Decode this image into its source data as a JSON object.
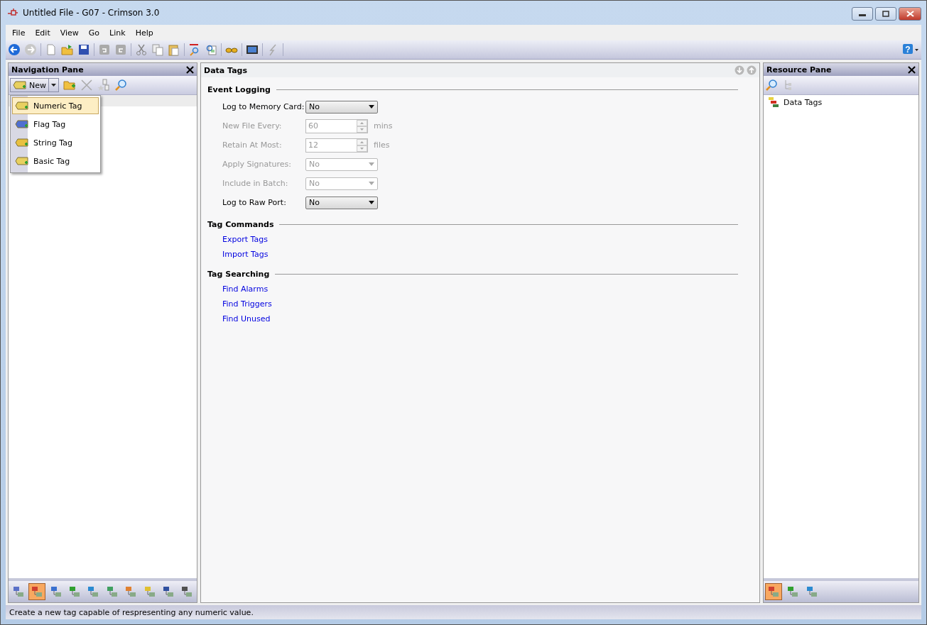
{
  "window": {
    "title": "Untitled File - G07 - Crimson 3.0"
  },
  "menu": [
    "File",
    "Edit",
    "View",
    "Go",
    "Link",
    "Help"
  ],
  "toolbar": {
    "help_glyph": "?"
  },
  "navigation_pane": {
    "title": "Navigation Pane",
    "new_button": "New",
    "new_menu": [
      {
        "label": "Numeric Tag",
        "kind": "numeric",
        "selected": true
      },
      {
        "label": "Flag Tag",
        "kind": "flag",
        "selected": false
      },
      {
        "label": "String Tag",
        "kind": "string",
        "selected": false
      },
      {
        "label": "Basic Tag",
        "kind": "basic",
        "selected": false
      }
    ],
    "bottom_tabs": [
      {
        "kind": "comms",
        "selected": false
      },
      {
        "kind": "tags",
        "selected": true
      },
      {
        "kind": "users",
        "selected": false
      },
      {
        "kind": "tree",
        "selected": false
      },
      {
        "kind": "web",
        "selected": false
      },
      {
        "kind": "chart",
        "selected": false
      },
      {
        "kind": "security",
        "selected": false
      },
      {
        "kind": "database",
        "selected": false
      },
      {
        "kind": "network",
        "selected": false
      },
      {
        "kind": "module",
        "selected": false
      }
    ]
  },
  "editor": {
    "title": "Data Tags",
    "sections": [
      {
        "title": "Event Logging",
        "rows": [
          {
            "label": "Log to Memory Card:",
            "kind": "dropdown",
            "value": "No",
            "disabled": false
          },
          {
            "label": "New File Every:",
            "kind": "spinner",
            "value": "60",
            "unit": "mins",
            "disabled": true
          },
          {
            "label": "Retain At Most:",
            "kind": "spinner",
            "value": "12",
            "unit": "files",
            "disabled": true
          },
          {
            "label": "Apply Signatures:",
            "kind": "dropdown",
            "value": "No",
            "disabled": true
          },
          {
            "label": "Include in Batch:",
            "kind": "dropdown",
            "value": "No",
            "disabled": true
          },
          {
            "label": "Log to Raw Port:",
            "kind": "dropdown",
            "value": "No",
            "disabled": false
          }
        ]
      },
      {
        "title": "Tag Commands",
        "links": [
          "Export Tags",
          "Import Tags"
        ]
      },
      {
        "title": "Tag Searching",
        "links": [
          "Find Alarms",
          "Find Triggers",
          "Find Unused"
        ]
      }
    ]
  },
  "resource_pane": {
    "title": "Resource Pane",
    "items": [
      "Data Tags"
    ],
    "bottom_tabs": [
      {
        "kind": "tags",
        "selected": true
      },
      {
        "kind": "tree",
        "selected": false
      },
      {
        "kind": "web",
        "selected": false
      }
    ]
  },
  "status_bar": "Create a new tag capable of respresenting any numeric value."
}
